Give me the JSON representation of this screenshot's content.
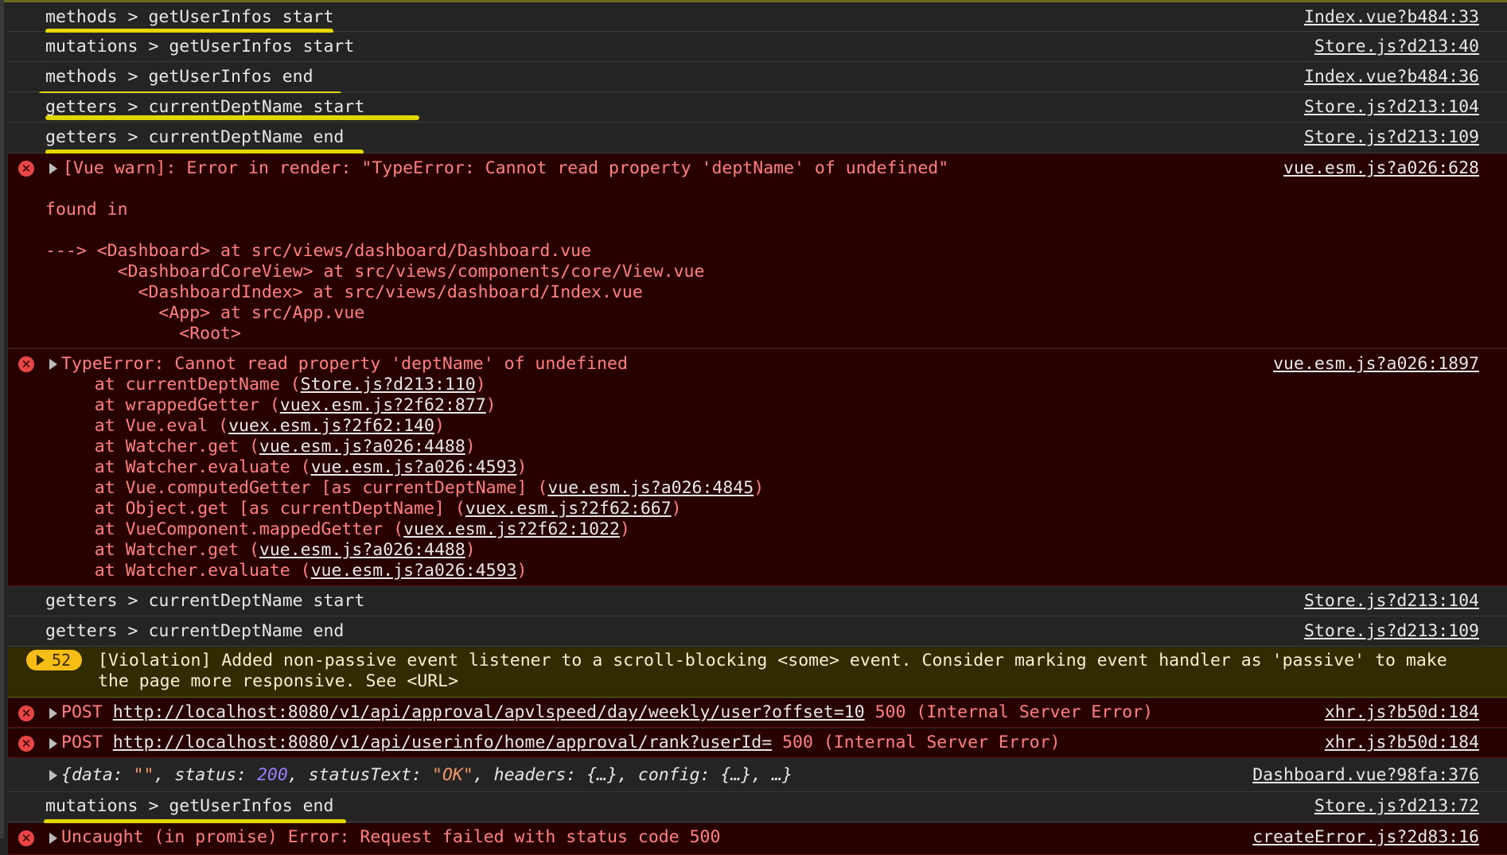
{
  "log_rows": [
    {
      "text": "methods > getUserInfos start",
      "src": "Index.vue?b484:33"
    },
    {
      "text": "mutations > getUserInfos start",
      "src": "Store.js?d213:40"
    },
    {
      "text": "methods > getUserInfos end",
      "src": "Index.vue?b484:36"
    },
    {
      "text": "getters > currentDeptName start",
      "src": "Store.js?d213:104"
    },
    {
      "text": "getters > currentDeptName end",
      "src": "Store.js?d213:109"
    }
  ],
  "vue_warn": {
    "message": "[Vue warn]: Error in render: \"TypeError: Cannot read property 'deptName' of undefined\"",
    "src": "vue.esm.js?a026:628",
    "found_in": "found in",
    "trace": [
      "---> <Dashboard> at src/views/dashboard/Dashboard.vue",
      "       <DashboardCoreView> at src/views/components/core/View.vue",
      "         <DashboardIndex> at src/views/dashboard/Index.vue",
      "           <App> at src/App.vue",
      "             <Root>"
    ]
  },
  "type_error": {
    "message": "TypeError: Cannot read property 'deptName' of undefined",
    "src": "vue.esm.js?a026:1897",
    "stack": [
      {
        "pre": "    at currentDeptName (",
        "link": "Store.js?d213:110",
        "post": ")"
      },
      {
        "pre": "    at wrappedGetter (",
        "link": "vuex.esm.js?2f62:877",
        "post": ")"
      },
      {
        "pre": "    at Vue.eval (",
        "link": "vuex.esm.js?2f62:140",
        "post": ")"
      },
      {
        "pre": "    at Watcher.get (",
        "link": "vue.esm.js?a026:4488",
        "post": ")"
      },
      {
        "pre": "    at Watcher.evaluate (",
        "link": "vue.esm.js?a026:4593",
        "post": ")"
      },
      {
        "pre": "    at Vue.computedGetter [as currentDeptName] (",
        "link": "vue.esm.js?a026:4845",
        "post": ")"
      },
      {
        "pre": "    at Object.get [as currentDeptName] (",
        "link": "vuex.esm.js?2f62:667",
        "post": ")"
      },
      {
        "pre": "    at VueComponent.mappedGetter (",
        "link": "vuex.esm.js?2f62:1022",
        "post": ")"
      },
      {
        "pre": "    at Watcher.get (",
        "link": "vue.esm.js?a026:4488",
        "post": ")"
      },
      {
        "pre": "    at Watcher.evaluate (",
        "link": "vue.esm.js?a026:4593",
        "post": ")"
      }
    ]
  },
  "log_rows_2": [
    {
      "text": "getters > currentDeptName start",
      "src": "Store.js?d213:104"
    },
    {
      "text": "getters > currentDeptName end",
      "src": "Store.js?d213:109"
    }
  ],
  "violation": {
    "count": "52",
    "line1": "[Violation] Added non-passive event listener to a scroll-blocking <some> event. Consider marking event handler as 'passive' to make",
    "line2": "the page more responsive. See <URL>"
  },
  "post_errors": [
    {
      "method": "POST ",
      "url": "http://localhost:8080/v1/api/approval/apvlspeed/day/weekly/user?offset=10",
      "status": " 500 (Internal Server Error)",
      "src": "xhr.js?b50d:184"
    },
    {
      "method": "POST ",
      "url": "http://localhost:8080/v1/api/userinfo/home/approval/rank?userId=",
      "status": " 500 (Internal Server Error)",
      "src": "xhr.js?b50d:184"
    }
  ],
  "object_log": {
    "p1": "{data: ",
    "v1": "\"\"",
    "p2": ", status: ",
    "v2": "200",
    "p3": ", statusText: ",
    "v3": "\"OK\"",
    "p4": ", headers: {…}, config: {…}, …}",
    "src": "Dashboard.vue?98fa:376"
  },
  "mutations_end": {
    "text": "mutations > getUserInfos end",
    "src": "Store.js?d213:72"
  },
  "uncaught": {
    "text": "Uncaught (in promise) Error: Request failed with status code 500",
    "src": "createError.js?2d83:16"
  },
  "colors": {
    "error_bg": "#290000",
    "error_text": "#ff8080",
    "warn_bg": "#332b00",
    "highlight": "#f5e600",
    "badge": "#f6bd16"
  }
}
